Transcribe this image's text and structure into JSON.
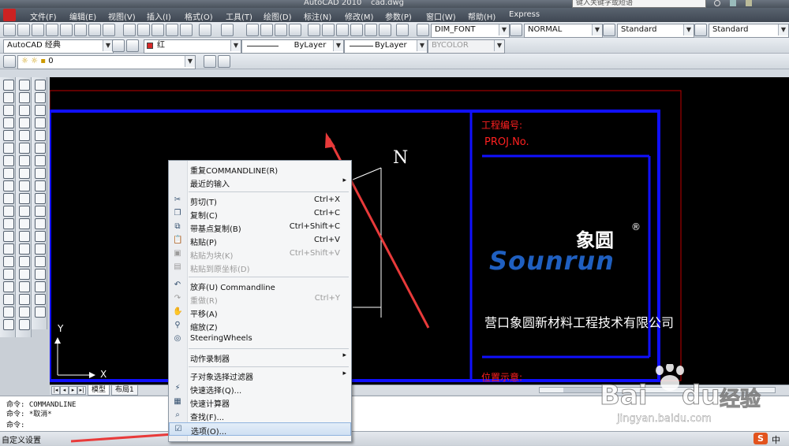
{
  "titlebar": {
    "app_title": "AutoCAD 2010",
    "file_name": "cad.dwg",
    "search_placeholder": "键入关键字或短语"
  },
  "menu": [
    "文件(F)",
    "编辑(E)",
    "视图(V)",
    "插入(I)",
    "格式(O)",
    "工具(T)",
    "绘图(D)",
    "标注(N)",
    "修改(M)",
    "参数(P)",
    "窗口(W)",
    "帮助(H)",
    "Express"
  ],
  "toolbar": {
    "dim_style": "DIM_FONT",
    "text_style": "NORMAL",
    "table_style": "Standard",
    "mleader_style": "Standard",
    "workspace": "AutoCAD 经典",
    "color": "红",
    "linetype": "ByLayer",
    "lineweight": "ByLayer",
    "plotstyle": "BYCOLOR",
    "layer": "0",
    "color_hex": "#d62828"
  },
  "drawing": {
    "north": "N",
    "proj_label_cn": "工程编号:",
    "proj_label_en": "PROJ.No.",
    "logo_cn": "象圆",
    "logo_en": "Sounrun",
    "logo_reg": "®",
    "company": "营口象圆新材料工程技术有限公司",
    "location_label": "位置示意:",
    "axis_y": "Y",
    "axis_x": "X",
    "frame_color": "#1010ff",
    "border_color": "#c00000",
    "text_red": "#ff2020",
    "text_white": "#ffffff",
    "logo_blue": "#1f5fc0"
  },
  "tabs": {
    "model": "模型",
    "layout1": "布局1"
  },
  "command": {
    "line1": "命令: COMMANDLINE",
    "line2": "命令: *取消*",
    "line3": "命令:"
  },
  "status": {
    "text": "自定义设置"
  },
  "context_menu": [
    {
      "label": "重复COMMANDLINE(R)",
      "shortcut": "",
      "submenu": false,
      "disabled": false,
      "icon": ""
    },
    {
      "label": "最近的输入",
      "shortcut": "",
      "submenu": true,
      "disabled": false,
      "icon": ""
    },
    {
      "label": "剪切(T)",
      "shortcut": "Ctrl+X",
      "submenu": false,
      "disabled": false,
      "icon": "scissors-icon"
    },
    {
      "label": "复制(C)",
      "shortcut": "Ctrl+C",
      "submenu": false,
      "disabled": false,
      "icon": "copy-icon"
    },
    {
      "label": "带基点复制(B)",
      "shortcut": "Ctrl+Shift+C",
      "submenu": false,
      "disabled": false,
      "icon": "copy-base-icon"
    },
    {
      "label": "粘贴(P)",
      "shortcut": "Ctrl+V",
      "submenu": false,
      "disabled": false,
      "icon": "paste-icon"
    },
    {
      "label": "粘贴为块(K)",
      "shortcut": "Ctrl+Shift+V",
      "submenu": false,
      "disabled": true,
      "icon": "paste-block-icon"
    },
    {
      "label": "粘贴到原坐标(D)",
      "shortcut": "",
      "submenu": false,
      "disabled": true,
      "icon": "paste-orig-icon"
    },
    {
      "label": "放弃(U) Commandline",
      "shortcut": "",
      "submenu": false,
      "disabled": false,
      "icon": "undo-icon"
    },
    {
      "label": "重做(R)",
      "shortcut": "Ctrl+Y",
      "submenu": false,
      "disabled": true,
      "icon": "redo-icon"
    },
    {
      "label": "平移(A)",
      "shortcut": "",
      "submenu": false,
      "disabled": false,
      "icon": "pan-icon"
    },
    {
      "label": "缩放(Z)",
      "shortcut": "",
      "submenu": false,
      "disabled": false,
      "icon": "zoom-icon"
    },
    {
      "label": "SteeringWheels",
      "shortcut": "",
      "submenu": false,
      "disabled": false,
      "icon": "wheel-icon"
    },
    {
      "label": "动作录制器",
      "shortcut": "",
      "submenu": true,
      "disabled": false,
      "icon": ""
    },
    {
      "label": "子对象选择过滤器",
      "shortcut": "",
      "submenu": true,
      "disabled": false,
      "icon": ""
    },
    {
      "label": "快速选择(Q)...",
      "shortcut": "",
      "submenu": false,
      "disabled": false,
      "icon": "quick-select-icon"
    },
    {
      "label": "快速计算器",
      "shortcut": "",
      "submenu": false,
      "disabled": false,
      "icon": "calculator-icon"
    },
    {
      "label": "查找(F)...",
      "shortcut": "",
      "submenu": false,
      "disabled": false,
      "icon": "find-icon"
    },
    {
      "label": "选项(O)...",
      "shortcut": "",
      "submenu": false,
      "disabled": false,
      "icon": "options-icon"
    }
  ],
  "watermark": {
    "brand": "Bai",
    "brand2": "du",
    "brand_cn": "经验",
    "url": "jingyan.baidu.com"
  },
  "tray": {
    "ime": "中"
  }
}
